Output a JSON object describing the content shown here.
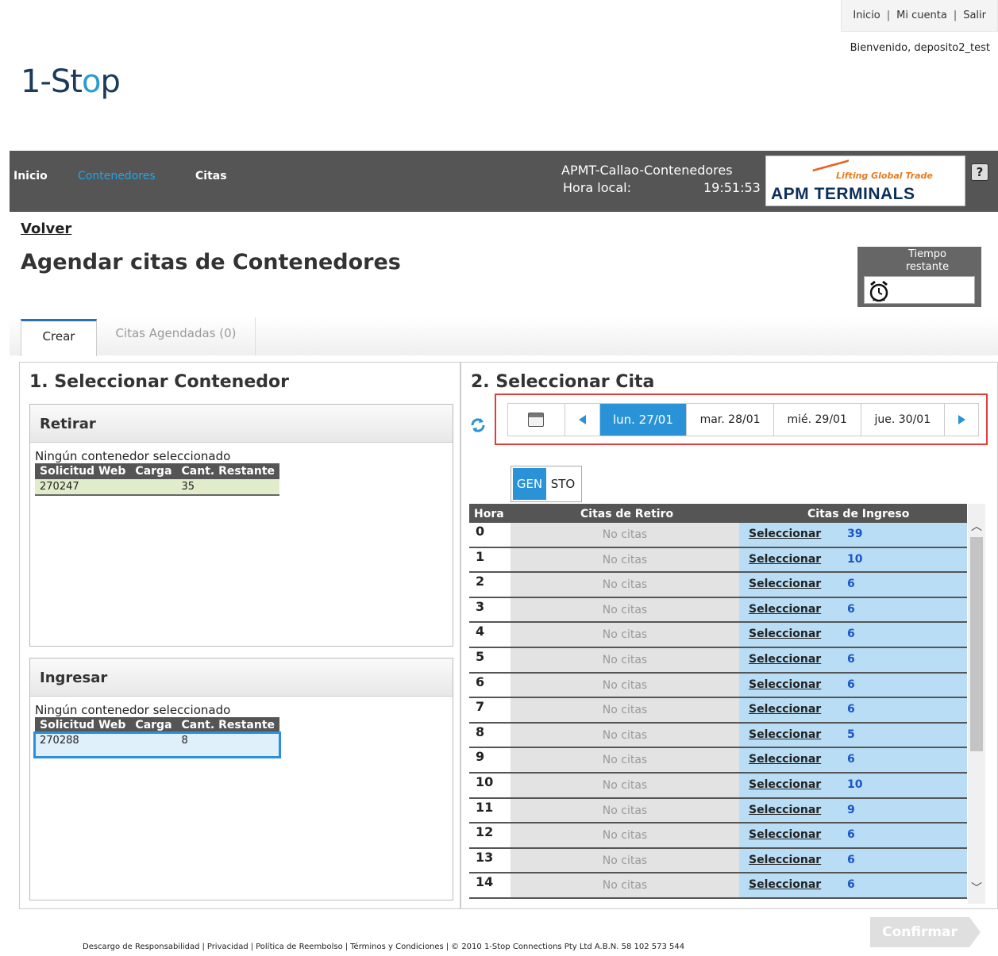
{
  "toplinks": {
    "inicio": "Inicio",
    "mi_cuenta": "Mi cuenta",
    "salir": "Salir",
    "sep": "|"
  },
  "welcome": "Bienvenido, deposito2_test",
  "logo": {
    "one": "1-St",
    "o": "o",
    "p": "p"
  },
  "nav": {
    "inicio": "Inicio",
    "contenedores": "Contenedores",
    "citas": "Citas"
  },
  "terminal": {
    "name": "APMT-Callao-Contenedores",
    "time_label": "Hora local:",
    "time": "19:51:53"
  },
  "apm_logo": {
    "tagline": "Lifting Global Trade",
    "name": "APM TERMINALS"
  },
  "volver": "Volver",
  "page_title": "Agendar citas de Contenedores",
  "timer": {
    "line1": "Tiempo",
    "line2": "restante"
  },
  "tabs": {
    "crear": "Crear",
    "agendadas": "Citas Agendadas (0)"
  },
  "left": {
    "title": "1. Seleccionar Contenedor",
    "retirar": {
      "header": "Retirar",
      "none": "Ningún contenedor seleccionado",
      "cols": [
        "Solicitud Web",
        "Carga",
        "Cant. Restante"
      ],
      "rows": [
        {
          "solicitud": "270247",
          "carga": "",
          "cant": "35"
        }
      ]
    },
    "ingresar": {
      "header": "Ingresar",
      "none": "Ningún contenedor seleccionado",
      "cols": [
        "Solicitud Web",
        "Carga",
        "Cant. Restante"
      ],
      "rows": [
        {
          "solicitud": "270288",
          "carga": "",
          "cant": "8"
        }
      ]
    }
  },
  "right": {
    "title": "2. Seleccionar Cita",
    "dates": [
      "lun. 27/01",
      "mar. 28/01",
      "mié. 29/01",
      "jue. 30/01"
    ],
    "active_date": "lun. 27/01",
    "toggle": [
      "GEN",
      "STO"
    ],
    "toggle_active": "GEN",
    "grid_cols": {
      "hora": "Hora",
      "retiro": "Citas de Retiro",
      "ingreso": "Citas de Ingreso"
    },
    "no_citas": "No citas",
    "select_label": "Seleccionar",
    "rows": [
      {
        "hora": "0",
        "count": "39"
      },
      {
        "hora": "1",
        "count": "10"
      },
      {
        "hora": "2",
        "count": "6"
      },
      {
        "hora": "3",
        "count": "6"
      },
      {
        "hora": "4",
        "count": "6"
      },
      {
        "hora": "5",
        "count": "6"
      },
      {
        "hora": "6",
        "count": "6"
      },
      {
        "hora": "7",
        "count": "6"
      },
      {
        "hora": "8",
        "count": "5"
      },
      {
        "hora": "9",
        "count": "6"
      },
      {
        "hora": "10",
        "count": "10"
      },
      {
        "hora": "11",
        "count": "9"
      },
      {
        "hora": "12",
        "count": "6"
      },
      {
        "hora": "13",
        "count": "6"
      },
      {
        "hora": "14",
        "count": "6"
      }
    ]
  },
  "confirm": "Confirmar",
  "footer": [
    "Descargo de Responsabilidad",
    "Privacidad",
    "Política de Reembolso",
    "Términos y Condiciones",
    "© 2010 1-Stop Connections Pty Ltd A.B.N. 58 102 573 544"
  ],
  "colors": {
    "accent": "#2a93d8",
    "nav_bg": "#555555",
    "highlight": "#e23c3c",
    "ingreso_bg": "#b9ddf4"
  }
}
